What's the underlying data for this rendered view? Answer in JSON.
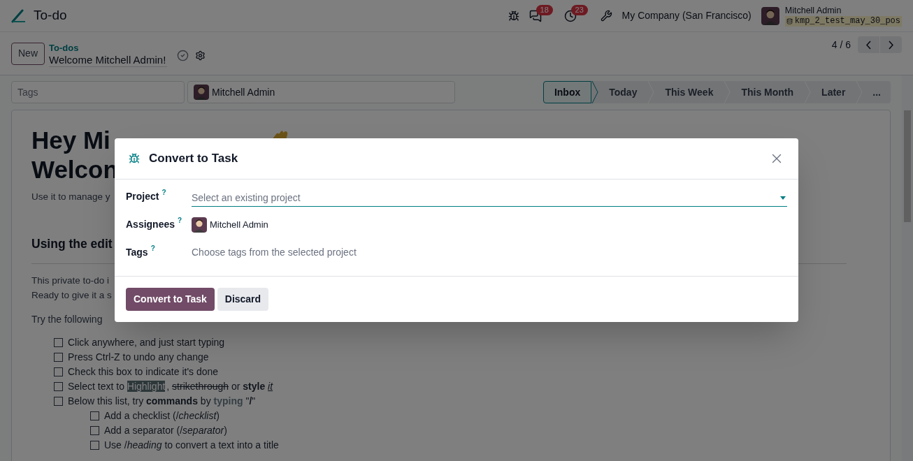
{
  "app": {
    "title": "To-do"
  },
  "systray": {
    "messages_count": "18",
    "activities_count": "23",
    "company": "My Company (San Francisco)",
    "user": "Mitchell Admin",
    "database": "kmp_2_test_may_30_pos"
  },
  "control_panel": {
    "new_button": "New",
    "breadcrumb": "To-dos",
    "record_title": "Welcome Mitchell Admin!",
    "pager": "4 / 6"
  },
  "form": {
    "tags_placeholder": "Tags",
    "assignee": "Mitchell Admin",
    "stages": [
      {
        "label": "Inbox",
        "selected": true
      },
      {
        "label": "Today",
        "selected": false
      },
      {
        "label": "This Week",
        "selected": false
      },
      {
        "label": "This Month",
        "selected": false
      },
      {
        "label": "Later",
        "selected": false
      }
    ],
    "more_stages": "...",
    "body": {
      "heading_lines": [
        "Hey Mi",
        "Welcon"
      ],
      "intro": "Use it to manage y",
      "section_title": "Using the edit",
      "paragraph_lines": [
        "This private to-do i",
        "Ready to give it a s"
      ],
      "try_line": "Try the following",
      "checklist": [
        {
          "checked": false,
          "segments": [
            {
              "kind": "plain",
              "text": "Click anywhere, and just start typing"
            }
          ]
        },
        {
          "checked": false,
          "segments": [
            {
              "kind": "plain",
              "text": "Press Ctrl-Z to undo any change"
            }
          ]
        },
        {
          "checked": false,
          "segments": [
            {
              "kind": "plain",
              "text": "Check this box to indicate it's done"
            }
          ]
        },
        {
          "checked": false,
          "segments": [
            {
              "kind": "plain",
              "text": "Select text to "
            },
            {
              "kind": "highlight",
              "text": "Highlight"
            },
            {
              "kind": "plain",
              "text": ", "
            },
            {
              "kind": "strike",
              "text": "strikethrough"
            },
            {
              "kind": "plain",
              "text": " or "
            },
            {
              "kind": "bold",
              "text": "style "
            },
            {
              "kind": "italic_underline",
              "text": "it"
            }
          ]
        },
        {
          "checked": false,
          "segments": [
            {
              "kind": "plain",
              "text": "Below this list, try "
            },
            {
              "kind": "bold",
              "text": "commands"
            },
            {
              "kind": "plain",
              "text": " by "
            },
            {
              "kind": "muted_bold",
              "text": "typing"
            },
            {
              "kind": "plain",
              "text": " \""
            },
            {
              "kind": "bold",
              "text": "/"
            },
            {
              "kind": "plain",
              "text": "\""
            }
          ],
          "children": [
            {
              "checked": false,
              "segments": [
                {
                  "kind": "plain",
                  "text": "Add a checklist (/"
                },
                {
                  "kind": "italic",
                  "text": "checklist"
                },
                {
                  "kind": "plain",
                  "text": ")"
                }
              ]
            },
            {
              "checked": false,
              "segments": [
                {
                  "kind": "plain",
                  "text": "Add a separator (/"
                },
                {
                  "kind": "italic",
                  "text": "separator"
                },
                {
                  "kind": "plain",
                  "text": ")"
                }
              ]
            },
            {
              "checked": false,
              "segments": [
                {
                  "kind": "plain",
                  "text": "Use /"
                },
                {
                  "kind": "italic",
                  "text": "heading"
                },
                {
                  "kind": "plain",
                  "text": " to convert a text into a title"
                }
              ]
            }
          ]
        }
      ]
    }
  },
  "dialog": {
    "title": "Convert to Task",
    "fields": [
      {
        "kind": "select",
        "label": "Project",
        "help": "?",
        "placeholder": "Select an existing project"
      },
      {
        "kind": "avatar",
        "label": "Assignees",
        "help": "?",
        "value": "Mitchell Admin"
      },
      {
        "kind": "tags",
        "label": "Tags",
        "help": "?",
        "placeholder": "Choose tags from the selected project"
      }
    ],
    "buttons": [
      {
        "label": "Convert to Task",
        "kind": "primary"
      },
      {
        "label": "Discard",
        "kind": "secondary"
      }
    ]
  }
}
